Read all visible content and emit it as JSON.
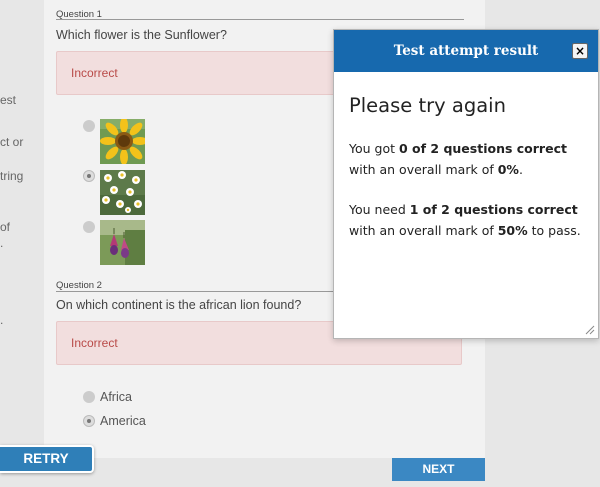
{
  "sidebar_fragments": [
    "est",
    "ct or",
    "tring",
    "of",
    ".",
    "."
  ],
  "question1": {
    "label": "Question 1",
    "text": "Which flower is the Sunflower?",
    "feedback": "Incorrect",
    "options": [
      {
        "icon": "sunflower-image",
        "selected": false
      },
      {
        "icon": "chamomile-image",
        "selected": true
      },
      {
        "icon": "fuchsia-image",
        "selected": false
      }
    ]
  },
  "question2": {
    "label": "Question 2",
    "text": "On which continent is the african lion found?",
    "feedback": "Incorrect",
    "options": [
      {
        "label": "Africa",
        "selected": false
      },
      {
        "label": "America",
        "selected": true
      }
    ]
  },
  "buttons": {
    "retry": "RETRY",
    "next": "NEXT"
  },
  "modal": {
    "header": "Test attempt result",
    "close": "×",
    "title": "Please try again",
    "result": {
      "pre": "You got ",
      "score": "0 of 2 questions correct",
      "mid": " with an overall mark of ",
      "mark": "0%",
      "post": "."
    },
    "requirement": {
      "pre": "You need ",
      "score": "1 of 2 questions correct",
      "mid": " with an overall mark of ",
      "mark": "50%",
      "post": " to pass."
    }
  },
  "colors": {
    "accent": "#1769ae",
    "button": "#2f7fb8",
    "feedback_bg": "#f2dede",
    "feedback_text": "#b94a48"
  }
}
